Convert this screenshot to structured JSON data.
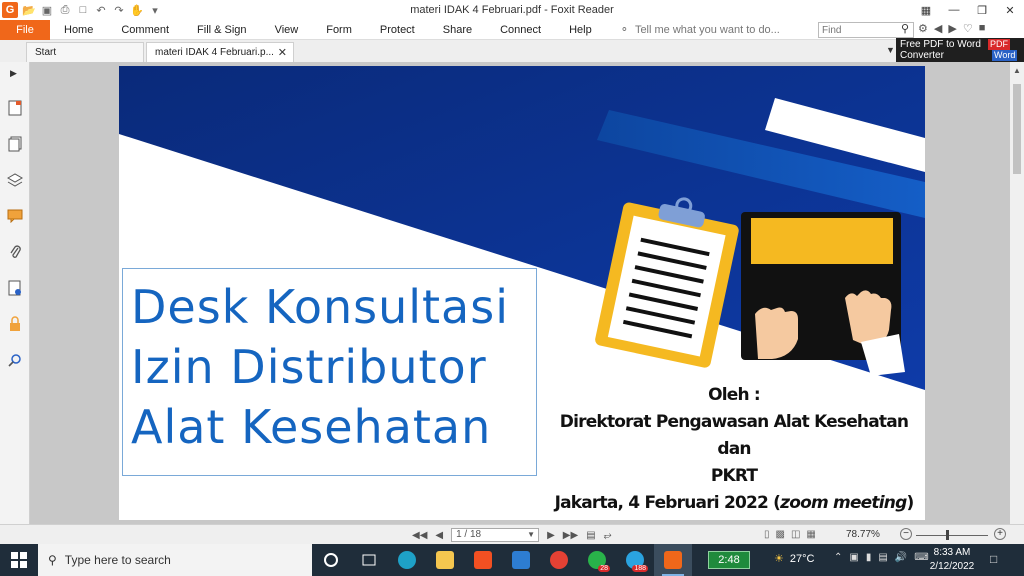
{
  "window": {
    "title": "materi IDAK 4 Februari.pdf - Foxit Reader"
  },
  "menu": {
    "file": "File",
    "items": [
      "Home",
      "Comment",
      "Fill & Sign",
      "View",
      "Form",
      "Protect",
      "Share",
      "Connect",
      "Help"
    ],
    "tell_me": "Tell me what you want to do..."
  },
  "search": {
    "placeholder": "Find"
  },
  "tabs": [
    {
      "label": "Start"
    },
    {
      "label": "materi IDAK 4 Februari.p..."
    }
  ],
  "promo": {
    "line1": "Free PDF to Word",
    "line2": "Converter",
    "pdf": "PDF",
    "word": "Word"
  },
  "slide": {
    "title_lines": [
      "Desk Konsultasi",
      "Izin Distributor",
      "Alat Kesehatan"
    ],
    "by_label": "Oleh :",
    "org_line1": "Direktorat Pengawasan Alat Kesehatan dan",
    "org_line2": "PKRT",
    "date_prefix": "Jakarta, 4 Februari 2022 (",
    "date_emph": "zoom meeting",
    "date_suffix": ")"
  },
  "navigation": {
    "page_display": "1 / 18",
    "zoom": "78.77%"
  },
  "taskbar": {
    "search_placeholder": "Type here to search",
    "battery_time": "2:48",
    "temperature": "27°C",
    "time": "8:33 AM",
    "date": "2/12/2022",
    "badge_whatsapp": "28",
    "badge_telegram": "188"
  },
  "colors": {
    "accent": "#f0671a",
    "slide_blue": "#1565c0",
    "slide_navy": "#0b2a8a",
    "taskbar": "#1f2d3a"
  }
}
